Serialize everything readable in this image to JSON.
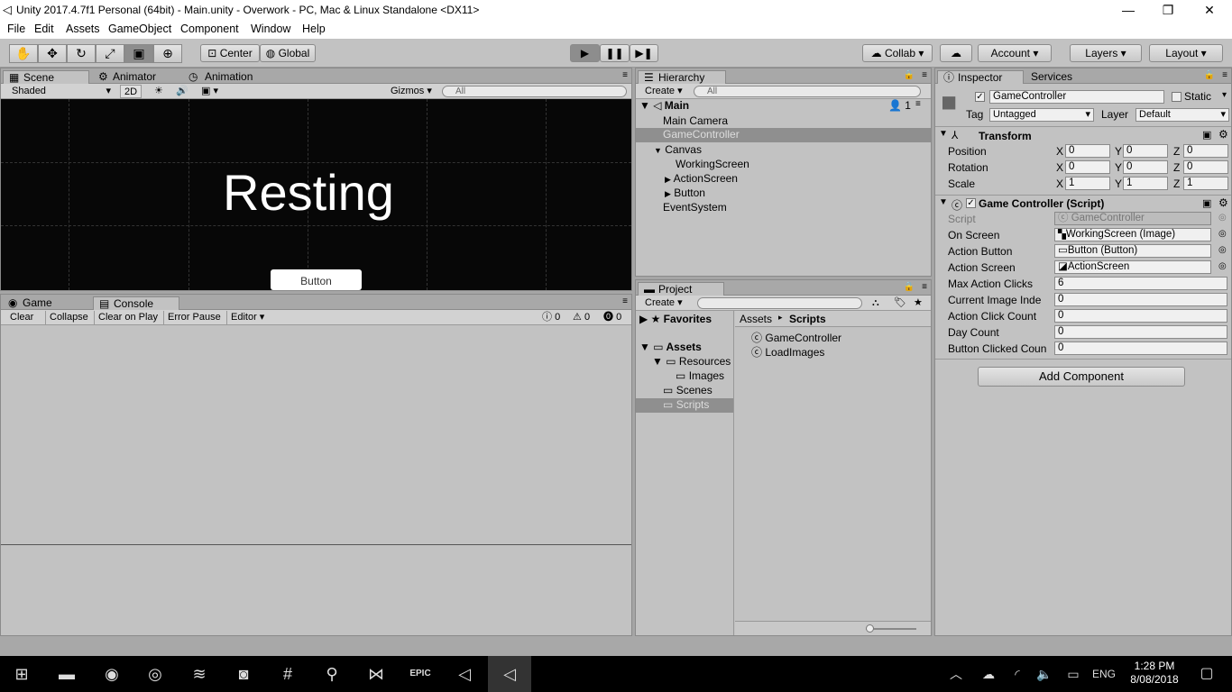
{
  "window": {
    "title": "Unity 2017.4.7f1 Personal (64bit) - Main.unity - Overwork - PC, Mac & Linux Standalone <DX11>",
    "minimize": "—",
    "maximize": "❐",
    "close": "✕"
  },
  "menu": [
    "File",
    "Edit",
    "Assets",
    "GameObject",
    "Component",
    "Window",
    "Help"
  ],
  "toolbar": {
    "tools": [
      "hand-tool",
      "move-tool",
      "rotate-tool",
      "scale-tool",
      "rect-tool",
      "transform-tool"
    ],
    "pivot": "Center",
    "space": "Global",
    "play": "▶",
    "pause": "❚❚",
    "step": "▶❚",
    "collab": "Collab",
    "account": "Account",
    "layers": "Layers",
    "layout": "Layout"
  },
  "scene": {
    "tabs": [
      "Scene",
      "Animator",
      "Animation"
    ],
    "shading": "Shaded",
    "mode2d": "2D",
    "gizmos": "Gizmos",
    "search_placeholder": "All",
    "resting_text": "Resting",
    "button_text": "Button"
  },
  "console": {
    "tabs": [
      "Game",
      "Console"
    ],
    "clear": "Clear",
    "collapse": "Collapse",
    "clear_on_play": "Clear on Play",
    "error_pause": "Error Pause",
    "editor": "Editor",
    "info_count": "0",
    "warn_count": "0",
    "error_count": "0"
  },
  "hierarchy": {
    "tab": "Hierarchy",
    "create": "Create",
    "search_placeholder": "All",
    "scene_name": "Main",
    "scene_count": "1",
    "items": [
      "Main Camera",
      "GameController",
      "Canvas",
      "WorkingScreen",
      "ActionScreen",
      "Button",
      "EventSystem"
    ]
  },
  "project": {
    "tab": "Project",
    "create": "Create",
    "favorites": "Favorites",
    "assets": "Assets",
    "folders": [
      "Resources",
      "Images",
      "Scenes",
      "Scripts"
    ],
    "breadcrumb_root": "Assets",
    "breadcrumb_current": "Scripts",
    "files": [
      "GameController",
      "LoadImages"
    ]
  },
  "inspector": {
    "tabs": [
      "Inspector",
      "Services"
    ],
    "object_name": "GameController",
    "static": "Static",
    "tag_label": "Tag",
    "tag": "Untagged",
    "layer_label": "Layer",
    "layer": "Default",
    "transform": {
      "title": "Transform",
      "position": "Position",
      "rotation": "Rotation",
      "scale": "Scale",
      "pos": [
        "0",
        "0",
        "0"
      ],
      "rot": [
        "0",
        "0",
        "0"
      ],
      "scl": [
        "1",
        "1",
        "1"
      ],
      "x": "X",
      "y": "Y",
      "z": "Z"
    },
    "script_component": {
      "title": "Game Controller (Script)",
      "fields": [
        {
          "label": "Script",
          "value": "GameController"
        },
        {
          "label": "On Screen",
          "value": "WorkingScreen (Image)"
        },
        {
          "label": "Action Button",
          "value": "Button (Button)"
        },
        {
          "label": "Action Screen",
          "value": "ActionScreen"
        },
        {
          "label": "Max Action Clicks",
          "value": "6"
        },
        {
          "label": "Current Image Inde",
          "value": "0"
        },
        {
          "label": "Action Click Count",
          "value": "0"
        },
        {
          "label": "Day Count",
          "value": "0"
        },
        {
          "label": "Button Clicked Coun",
          "value": "0"
        }
      ]
    },
    "add_component": "Add Component"
  },
  "taskbar": {
    "time": "1:28 PM",
    "date": "8/08/2018",
    "lang": "ENG",
    "epic": "EPIC"
  }
}
